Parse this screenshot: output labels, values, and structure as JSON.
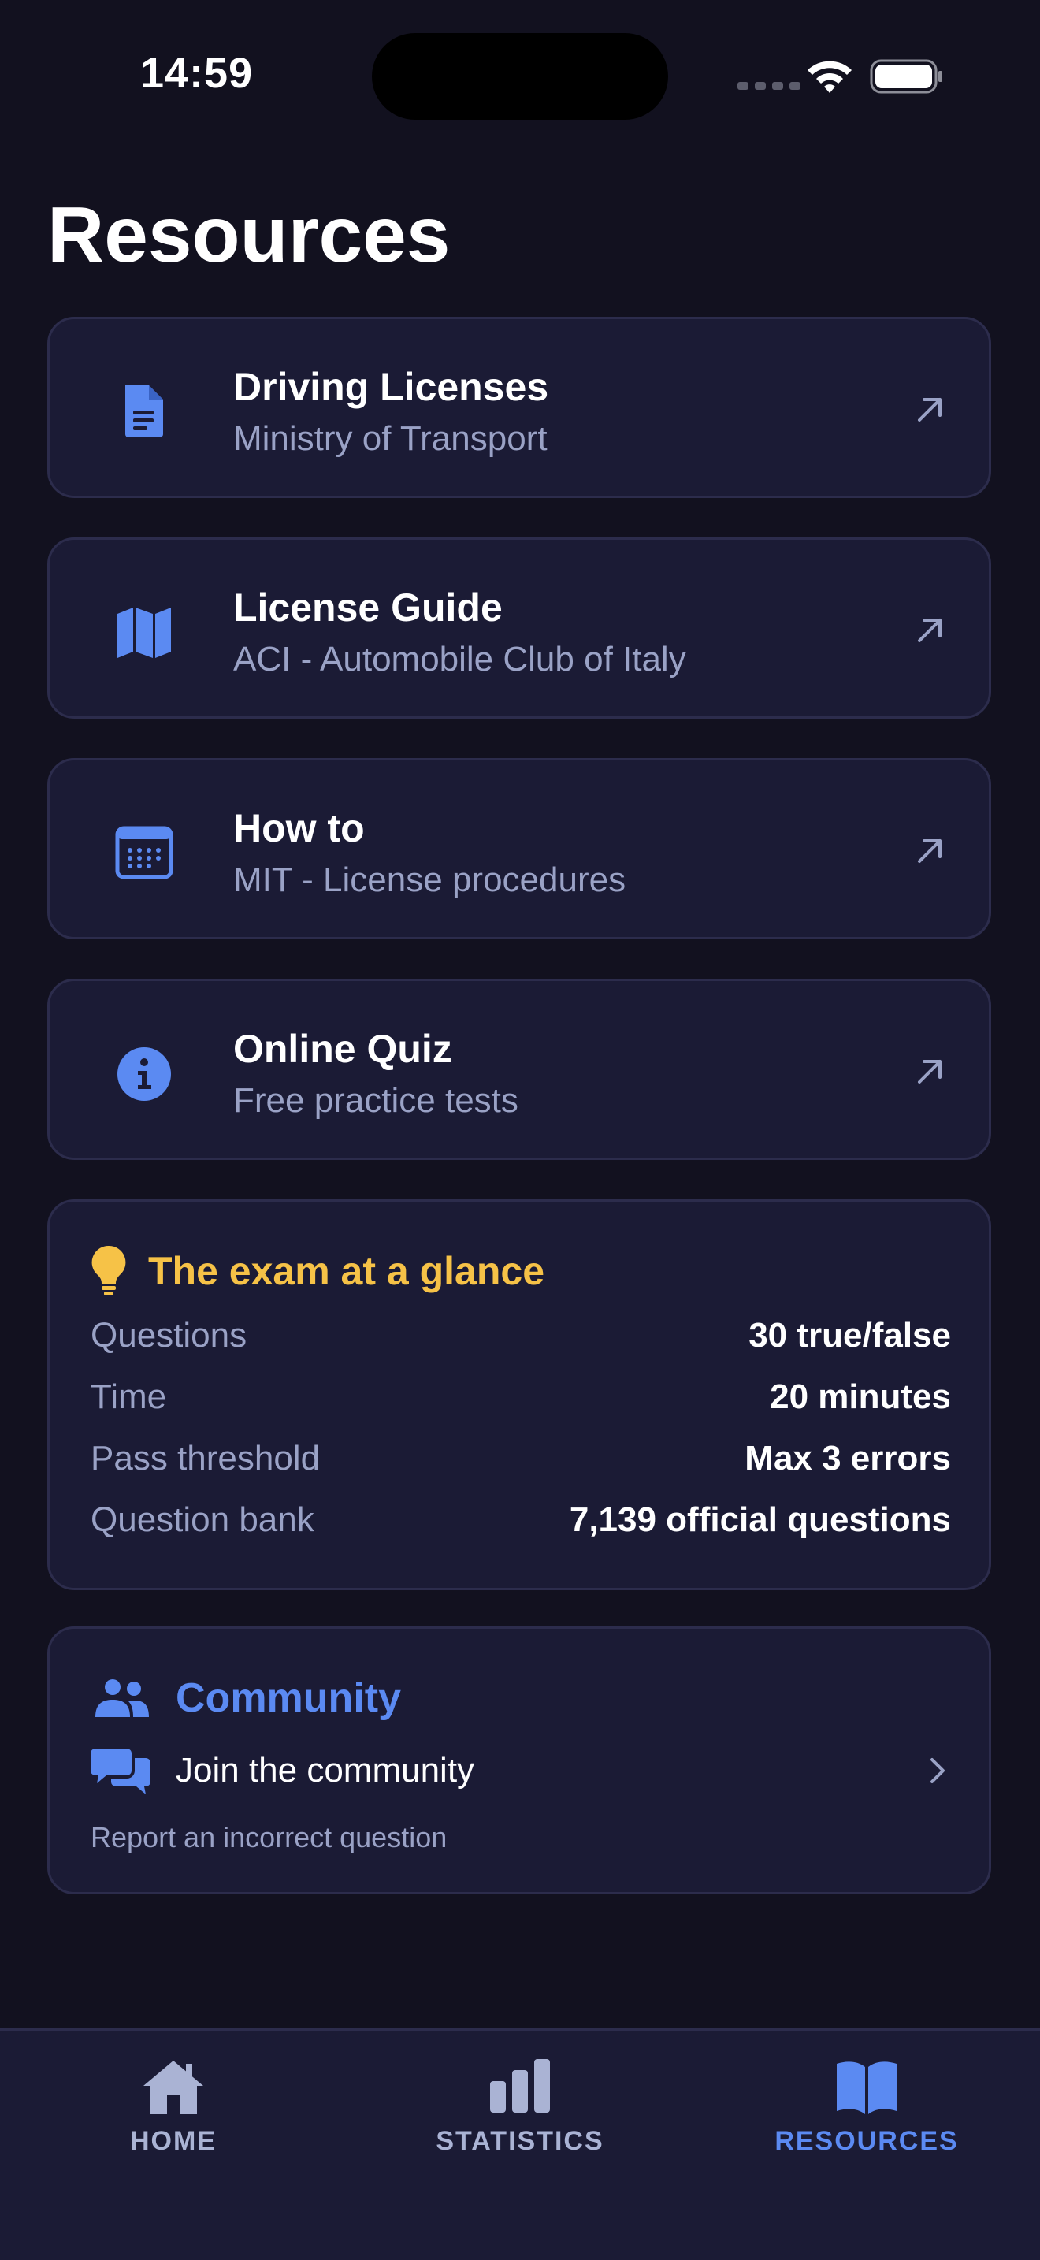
{
  "status_bar": {
    "time": "14:59"
  },
  "page": {
    "title": "Resources"
  },
  "links": [
    {
      "title": "Driving Licenses",
      "subtitle": "Ministry of Transport",
      "icon": "document-icon"
    },
    {
      "title": "License Guide",
      "subtitle": "ACI - Automobile Club of Italy",
      "icon": "map-icon"
    },
    {
      "title": "How to",
      "subtitle": "MIT - License procedures",
      "icon": "calendar-icon"
    },
    {
      "title": "Online Quiz",
      "subtitle": "Free practice tests",
      "icon": "info-icon"
    }
  ],
  "exam": {
    "title": "The exam at a glance",
    "icon": "lightbulb-icon",
    "rows": [
      {
        "label": "Questions",
        "value": "30 true/false"
      },
      {
        "label": "Time",
        "value": "20 minutes"
      },
      {
        "label": "Pass threshold",
        "value": "Max 3 errors"
      },
      {
        "label": "Question bank",
        "value": "7,139 official questions"
      }
    ]
  },
  "community": {
    "title": "Community",
    "join_label": "Join the community",
    "report_label": "Report an incorrect question"
  },
  "tabs": [
    {
      "label": "HOME",
      "icon": "home-icon",
      "active": false
    },
    {
      "label": "STATISTICS",
      "icon": "bar-chart-icon",
      "active": false
    },
    {
      "label": "RESOURCES",
      "icon": "book-icon",
      "active": true
    }
  ],
  "colors": {
    "background": "#12111f",
    "card": "#1b1b35",
    "card_border": "#2c2c4c",
    "accent_blue": "#5b8af2",
    "accent_yellow": "#f6c247",
    "muted_text": "#9aa2c6",
    "inactive_tab": "#aab3d4"
  }
}
